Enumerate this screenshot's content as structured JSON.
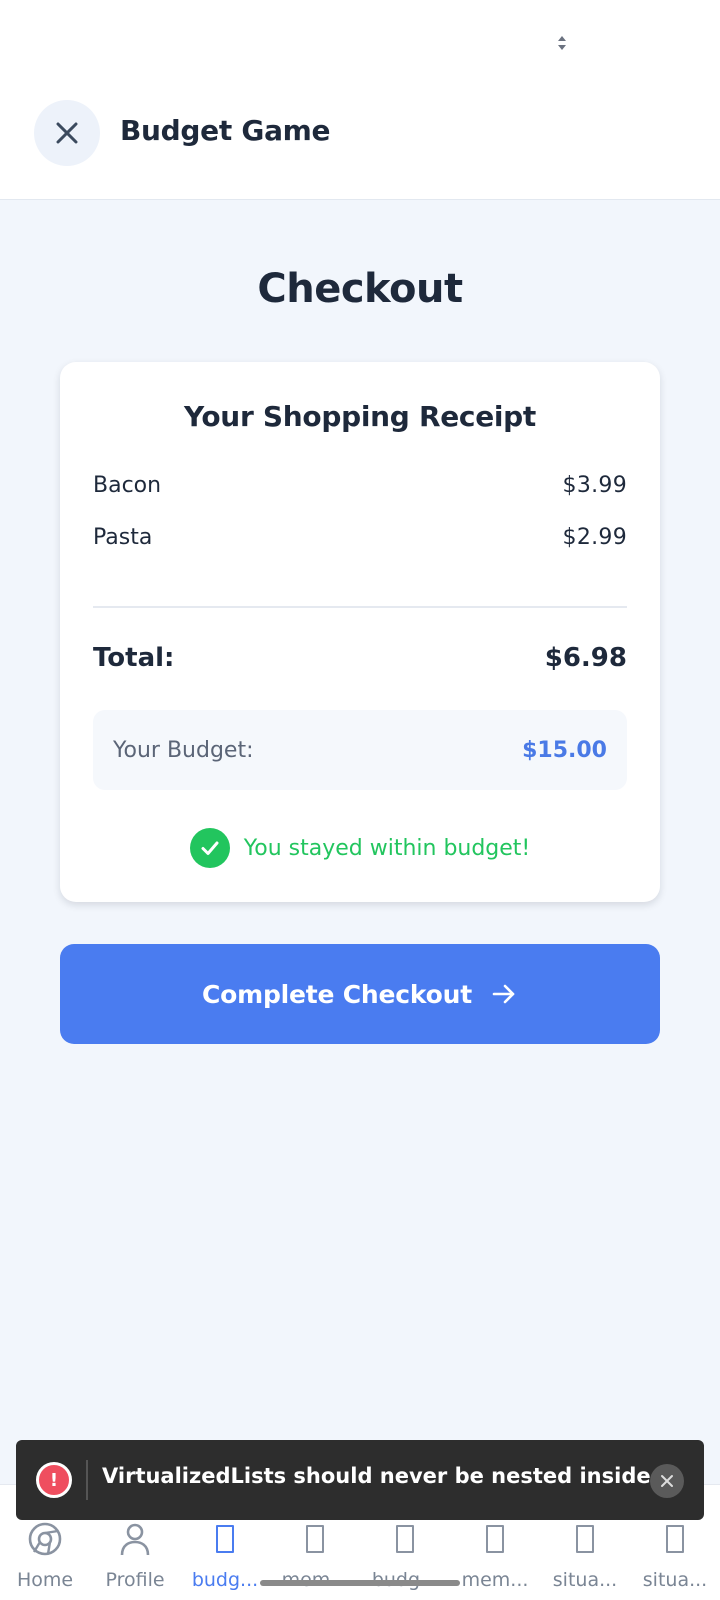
{
  "header": {
    "title": "Budget Game",
    "close_icon": "close-icon"
  },
  "page": {
    "title": "Checkout"
  },
  "receipt": {
    "title": "Your Shopping Receipt",
    "items": [
      {
        "name": "Bacon",
        "price": "$3.99"
      },
      {
        "name": "Pasta",
        "price": "$2.99"
      }
    ],
    "total_label": "Total:",
    "total_value": "$6.98",
    "budget_label": "Your Budget:",
    "budget_value": "$15.00",
    "status_text": "You stayed within budget!"
  },
  "checkout_button": {
    "label": "Complete Checkout",
    "icon": "arrow-right-icon"
  },
  "toast": {
    "message": "VirtualizedLists should never be nested inside pl...",
    "icon": "alert-icon"
  },
  "tabs": [
    {
      "label": "Home",
      "icon": "chrome-icon",
      "active": false
    },
    {
      "label": "Profile",
      "icon": "user-icon",
      "active": false
    },
    {
      "label": "budg...",
      "icon": "placeholder-icon",
      "active": true
    },
    {
      "label": "mem...",
      "icon": "placeholder-icon",
      "active": false
    },
    {
      "label": "budg...",
      "icon": "placeholder-icon",
      "active": false
    },
    {
      "label": "mem...",
      "icon": "placeholder-icon",
      "active": false
    },
    {
      "label": "situa...",
      "icon": "placeholder-icon",
      "active": false
    },
    {
      "label": "situa...",
      "icon": "placeholder-icon",
      "active": false
    }
  ],
  "colors": {
    "accent": "#4a7cf0",
    "success": "#22c55e",
    "budget_value": "#4a7ae6",
    "toast_bg": "#2d2d2d",
    "alert": "#ef4e5f",
    "background": "#f2f6fc"
  }
}
